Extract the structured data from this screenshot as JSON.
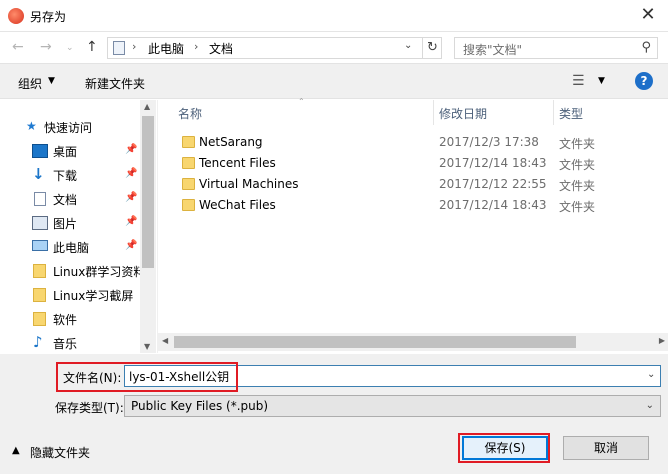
{
  "window": {
    "title": "另存为"
  },
  "address": {
    "crumbs": [
      "此电脑",
      "文档"
    ]
  },
  "search": {
    "placeholder": "搜索\"文档\""
  },
  "toolbar": {
    "organize": "组织",
    "new_folder": "新建文件夹",
    "help": "?"
  },
  "nav": {
    "quick_access": "快速访问",
    "items": [
      {
        "label": "桌面",
        "icon": "desktop-icon",
        "pinned": true
      },
      {
        "label": "下载",
        "icon": "download-icon",
        "pinned": true
      },
      {
        "label": "文档",
        "icon": "document-icon",
        "pinned": true
      },
      {
        "label": "图片",
        "icon": "picture-icon",
        "pinned": true
      },
      {
        "label": "此电脑",
        "icon": "computer-icon",
        "pinned": true
      },
      {
        "label": "Linux群学习资料",
        "icon": "folder-icon",
        "pinned": false
      },
      {
        "label": "Linux学习截屏",
        "icon": "folder-icon",
        "pinned": false
      },
      {
        "label": "软件",
        "icon": "folder-icon",
        "pinned": false
      },
      {
        "label": "音乐",
        "icon": "music-icon",
        "pinned": false
      }
    ]
  },
  "columns": {
    "name": "名称",
    "date": "修改日期",
    "type": "类型"
  },
  "files": [
    {
      "name": "NetSarang",
      "date": "2017/12/3 17:38",
      "type": "文件夹"
    },
    {
      "name": "Tencent Files",
      "date": "2017/12/14 18:43",
      "type": "文件夹"
    },
    {
      "name": "Virtual Machines",
      "date": "2017/12/12 22:55",
      "type": "文件夹"
    },
    {
      "name": "WeChat Files",
      "date": "2017/12/14 18:43",
      "type": "文件夹"
    }
  ],
  "form": {
    "filename_label": "文件名(N):",
    "filename_value": "lys-01-Xshell公钥",
    "type_label": "保存类型(T):",
    "type_value": "Public Key Files (*.pub)"
  },
  "footer": {
    "hide_folders": "隐藏文件夹",
    "save": "保存(S)",
    "cancel": "取消"
  },
  "colors": {
    "highlight": "#e01b24",
    "accent": "#0078d7"
  }
}
